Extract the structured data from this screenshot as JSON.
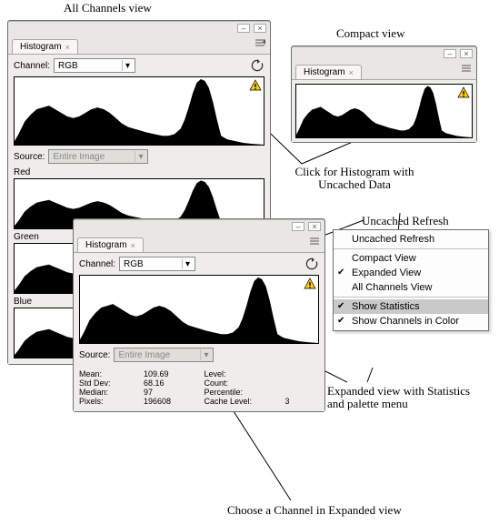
{
  "labels": {
    "all_channels_title": "All Channels view",
    "compact_title": "Compact  view",
    "uncached_click": "Click for Histogram with Uncached Data",
    "uncached_refresh": "Uncached Refresh",
    "expanded_stats": "Expanded view with Statistics and palette menu",
    "choose_channel": "Choose a Channel in Expanded view"
  },
  "panel": {
    "tab": "Histogram",
    "channel_label": "Channel:",
    "channel_value": "RGB",
    "source_label": "Source:",
    "source_value": "Entire Image"
  },
  "channels": {
    "red": "Red",
    "green": "Green",
    "blue": "Blue"
  },
  "stats": {
    "mean_k": "Mean:",
    "mean_v": "109.69",
    "stddev_k": "Std Dev:",
    "stddev_v": "68.16",
    "median_k": "Median:",
    "median_v": "97",
    "pixels_k": "Pixels:",
    "pixels_v": "196608",
    "level_k": "Level:",
    "level_v": "",
    "count_k": "Count:",
    "count_v": "",
    "percentile_k": "Percentile:",
    "percentile_v": "",
    "cache_k": "Cache Level:",
    "cache_v": "3"
  },
  "menu": {
    "uncached": "Uncached Refresh",
    "compact": "Compact View",
    "expanded": "Expanded View",
    "allch": "All Channels View",
    "showstats": "Show Statistics",
    "showcolor": "Show Channels in Color"
  }
}
